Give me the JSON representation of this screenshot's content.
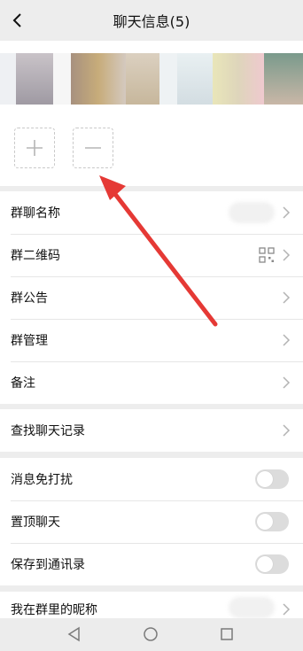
{
  "header": {
    "title": "聊天信息(5)"
  },
  "members": {
    "add_icon": "plus-icon",
    "remove_icon": "minus-icon",
    "avatar_colors": [
      "#e8e3ea",
      "#a9a0a7",
      "#cfc4c6",
      "#9b8e86",
      "#b39a78",
      "#cbb998",
      "#d8cfc2",
      "#d9e2e6",
      "#e5e4b6",
      "#e3dab7",
      "#7a9a8c",
      "#d7cfc7"
    ]
  },
  "rows_group1": [
    {
      "label": "群聊名称"
    },
    {
      "label": "群二维码"
    },
    {
      "label": "群公告"
    },
    {
      "label": "群管理"
    },
    {
      "label": "备注"
    }
  ],
  "row_search": {
    "label": "查找聊天记录"
  },
  "rows_toggles": [
    {
      "label": "消息免打扰",
      "on": false
    },
    {
      "label": "置顶聊天",
      "on": false
    },
    {
      "label": "保存到通讯录",
      "on": false
    }
  ],
  "row_nickname": {
    "label": "我在群里的昵称"
  },
  "colors": {
    "annotation_arrow": "#e53935"
  }
}
